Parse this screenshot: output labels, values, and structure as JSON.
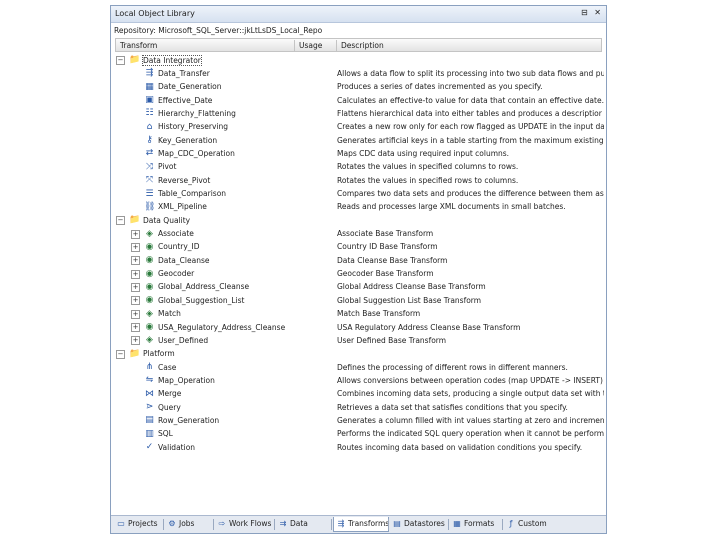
{
  "window": {
    "title": "Local Object Library",
    "icons": "⊟ ✕"
  },
  "repository": "Repository: Microsoft_SQL_Server::jkLtLsDS_Local_Repo",
  "columns": {
    "transform": "Transform",
    "usage": "Usage",
    "description": "Description"
  },
  "tree": [
    {
      "type": "category",
      "expand": "−",
      "icon": "📁",
      "label": "Data Integrator",
      "desc": ""
    },
    {
      "type": "item",
      "icon": "⇶",
      "label": "Data_Transfer",
      "desc": "Allows a data flow to split its processing into two sub data flows and push"
    },
    {
      "type": "item",
      "icon": "▦",
      "label": "Date_Generation",
      "desc": "Produces a series of dates incremented as you specify."
    },
    {
      "type": "item",
      "icon": "▣",
      "label": "Effective_Date",
      "desc": "Calculates an effective-to value for data that contain an effective date."
    },
    {
      "type": "item",
      "icon": "☷",
      "label": "Hierarchy_Flattening",
      "desc": "Flattens hierarchical data into either tables and produces a descriptior"
    },
    {
      "type": "item",
      "icon": "⌂",
      "label": "History_Preserving",
      "desc": "Creates a new row only for each row flagged as UPDATE in the input data"
    },
    {
      "type": "item",
      "icon": "⚷",
      "label": "Key_Generation",
      "desc": "Generates artificial keys in a table starting from the maximum existing key"
    },
    {
      "type": "item",
      "icon": "⇄",
      "label": "Map_CDC_Operation",
      "desc": "Maps CDC data using required input columns."
    },
    {
      "type": "item",
      "icon": "⤨",
      "label": "Pivot",
      "desc": "Rotates the values in specified columns to rows."
    },
    {
      "type": "item",
      "icon": "⤧",
      "label": "Reverse_Pivot",
      "desc": "Rotates the values in specified rows to columns."
    },
    {
      "type": "item",
      "icon": "☰",
      "label": "Table_Comparison",
      "desc": "Compares two data sets and produces the difference between them as a c"
    },
    {
      "type": "item",
      "icon": "⛓",
      "label": "XML_Pipeline",
      "desc": "Reads and processes large XML documents in small batches."
    },
    {
      "type": "category",
      "expand": "−",
      "icon": "📁",
      "label": "Data Quality",
      "desc": ""
    },
    {
      "type": "subcat",
      "expand": "+",
      "icon": "◈",
      "label": "Associate",
      "desc": "Associate Base Transform"
    },
    {
      "type": "subcat",
      "expand": "+",
      "icon": "◉",
      "label": "Country_ID",
      "desc": "Country ID Base Transform"
    },
    {
      "type": "subcat",
      "expand": "+",
      "icon": "◉",
      "label": "Data_Cleanse",
      "desc": "Data Cleanse Base Transform"
    },
    {
      "type": "subcat",
      "expand": "+",
      "icon": "◉",
      "label": "Geocoder",
      "desc": "Geocoder Base Transform"
    },
    {
      "type": "subcat",
      "expand": "+",
      "icon": "◉",
      "label": "Global_Address_Cleanse",
      "desc": "Global Address Cleanse Base Transform"
    },
    {
      "type": "subcat",
      "expand": "+",
      "icon": "◉",
      "label": "Global_Suggestion_List",
      "desc": "Global Suggestion List Base Transform"
    },
    {
      "type": "subcat",
      "expand": "+",
      "icon": "◈",
      "label": "Match",
      "desc": "Match Base Transform"
    },
    {
      "type": "subcat",
      "expand": "+",
      "icon": "◉",
      "label": "USA_Regulatory_Address_Cleanse",
      "desc": "USA Regulatory Address Cleanse Base Transform"
    },
    {
      "type": "subcat",
      "expand": "+",
      "icon": "◈",
      "label": "User_Defined",
      "desc": "User Defined Base Transform"
    },
    {
      "type": "category",
      "expand": "−",
      "icon": "📁",
      "label": "Platform",
      "desc": ""
    },
    {
      "type": "item",
      "icon": "⋔",
      "label": "Case",
      "desc": "Defines the processing of different rows in different manners."
    },
    {
      "type": "item",
      "icon": "⇋",
      "label": "Map_Operation",
      "desc": "Allows conversions between operation codes (map UPDATE -> INSERT) in"
    },
    {
      "type": "item",
      "icon": "⋈",
      "label": "Merge",
      "desc": "Combines incoming data sets, producing a single output data set with the s"
    },
    {
      "type": "item",
      "icon": "⋗",
      "label": "Query",
      "desc": "Retrieves a data set that satisfies conditions that you specify."
    },
    {
      "type": "item",
      "icon": "▤",
      "label": "Row_Generation",
      "desc": "Generates a column filled with int values starting at zero and incrementing"
    },
    {
      "type": "item",
      "icon": "▥",
      "label": "SQL",
      "desc": "Performs the indicated SQL query operation when it cannot be performed"
    },
    {
      "type": "item",
      "icon": "✓",
      "label": "Validation",
      "desc": "Routes incoming data based on validation conditions you specify."
    }
  ],
  "tabs": [
    {
      "label": "Projects",
      "icon": "▭"
    },
    {
      "label": "Jobs",
      "icon": "⚙"
    },
    {
      "label": "Work Flows",
      "icon": "⇨"
    },
    {
      "label": "Data Flows",
      "icon": "⇉"
    },
    {
      "label": "Transforms",
      "icon": "⇶",
      "active": true
    },
    {
      "label": "Datastores",
      "icon": "▤"
    },
    {
      "label": "Formats",
      "icon": "▦"
    },
    {
      "label": "Custom Functions",
      "icon": "ƒ"
    }
  ]
}
